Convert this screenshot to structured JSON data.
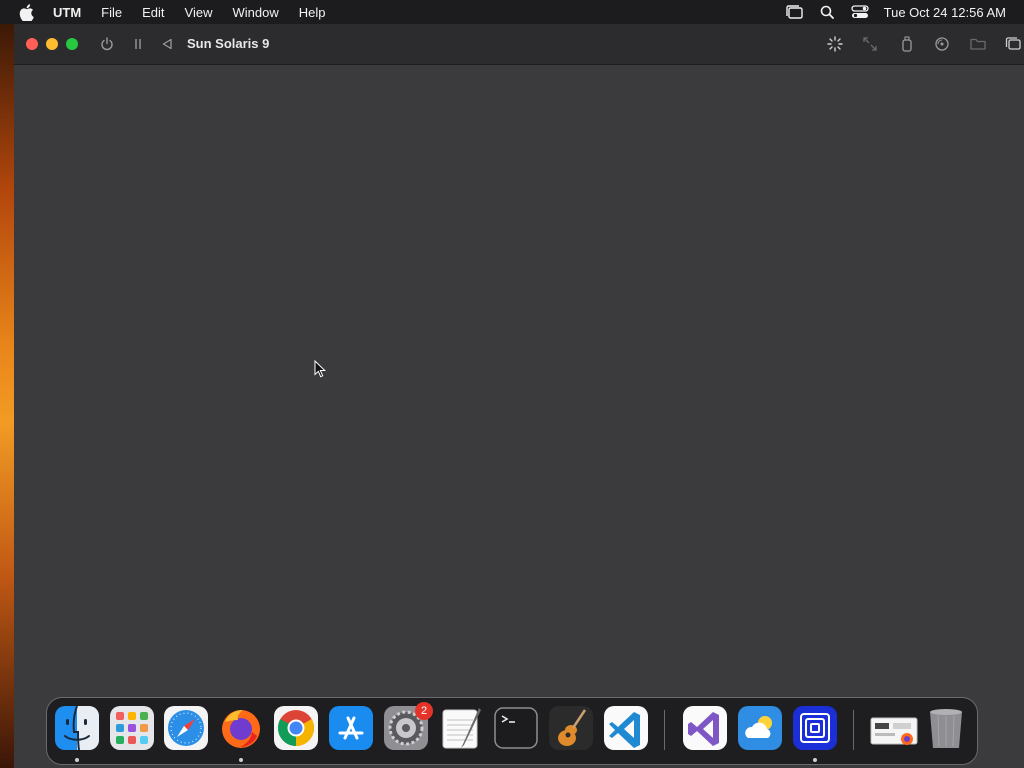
{
  "menubar": {
    "app_name": "UTM",
    "menus": [
      "File",
      "Edit",
      "View",
      "Window",
      "Help"
    ],
    "clock": "Tue Oct 24  12:56 AM"
  },
  "window": {
    "title": "Sun Solaris 9"
  },
  "dock": {
    "apps": [
      {
        "name": "Finder",
        "running": true
      },
      {
        "name": "Launchpad",
        "running": false
      },
      {
        "name": "Safari",
        "running": false
      },
      {
        "name": "Firefox",
        "running": true
      },
      {
        "name": "Google Chrome",
        "running": false
      },
      {
        "name": "App Store",
        "running": false
      },
      {
        "name": "System Settings",
        "running": false
      },
      {
        "name": "TextEdit",
        "running": false
      },
      {
        "name": "Terminal",
        "running": false
      },
      {
        "name": "GarageBand",
        "running": false
      },
      {
        "name": "Visual Studio Code",
        "running": false
      },
      {
        "name": "Visual Studio",
        "running": false
      },
      {
        "name": "Weather",
        "running": false
      },
      {
        "name": "UTM",
        "running": true
      },
      {
        "name": "Downloads",
        "running": false
      },
      {
        "name": "Trash",
        "running": false
      }
    ],
    "settings_badge": "2"
  },
  "colors": {
    "close": "#ff5f57",
    "minimize": "#febc2e",
    "maximize": "#28c840",
    "badge": "#e5332a"
  }
}
